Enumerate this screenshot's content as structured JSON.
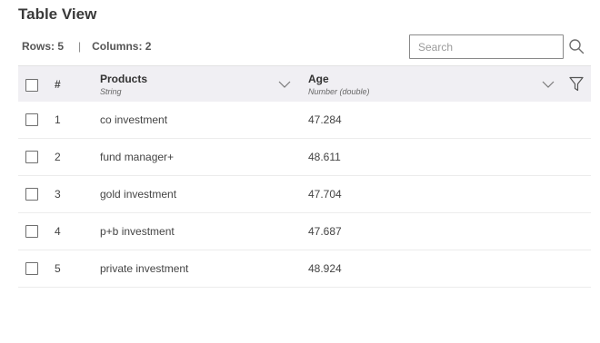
{
  "header": {
    "title": "Table View",
    "rows_label": "Rows: 5",
    "separator": "|",
    "columns_label": "Columns: 2"
  },
  "search": {
    "placeholder": "Search",
    "value": "",
    "icon": "search-icon"
  },
  "table": {
    "index_header": "#",
    "columns": [
      {
        "name": "Products",
        "type": "String",
        "icon": "chevron-down-icon"
      },
      {
        "name": "Age",
        "type": "Number (double)",
        "icon": "chevron-down-icon"
      }
    ],
    "filter_icon": "filter-icon",
    "rows": [
      {
        "index": "1",
        "product": "co investment",
        "age": "47.284"
      },
      {
        "index": "2",
        "product": "fund manager+",
        "age": "48.611"
      },
      {
        "index": "3",
        "product": "gold investment",
        "age": "47.704"
      },
      {
        "index": "4",
        "product": "p+b investment",
        "age": "47.687"
      },
      {
        "index": "5",
        "product": "private investment",
        "age": "48.924"
      }
    ]
  },
  "colors": {
    "header_bg": "#f0eff3",
    "border": "#8a8a8a",
    "text": "#444444"
  }
}
